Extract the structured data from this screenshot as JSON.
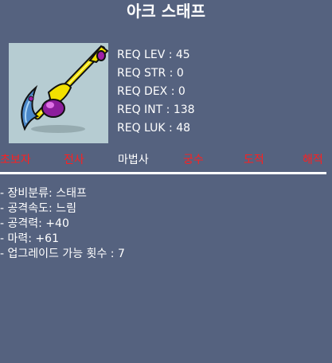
{
  "item": {
    "name": "아크 스태프",
    "icon": "arc-staff-icon"
  },
  "requirements": [
    "REQ LEV : 45",
    "REQ STR : 0",
    "REQ DEX : 0",
    "REQ INT : 138",
    "REQ LUK : 48"
  ],
  "jobs": [
    {
      "label": "초보자",
      "available": false
    },
    {
      "label": "전사",
      "available": false
    },
    {
      "label": "마법사",
      "available": true
    },
    {
      "label": "궁수",
      "available": false
    },
    {
      "label": "도적",
      "available": false
    },
    {
      "label": "해적",
      "available": false
    }
  ],
  "stats": [
    "- 장비분류: 스태프",
    "- 공격속도: 느림",
    "- 공격력: +40",
    "- 마력: +61",
    "- 업그레이드 가능 횟수 : 7"
  ],
  "colors": {
    "background": "#55627f",
    "icon_frame": "#b6ccd2",
    "job_unavailable": "#ff1f1f",
    "job_available": "#ffffff"
  }
}
